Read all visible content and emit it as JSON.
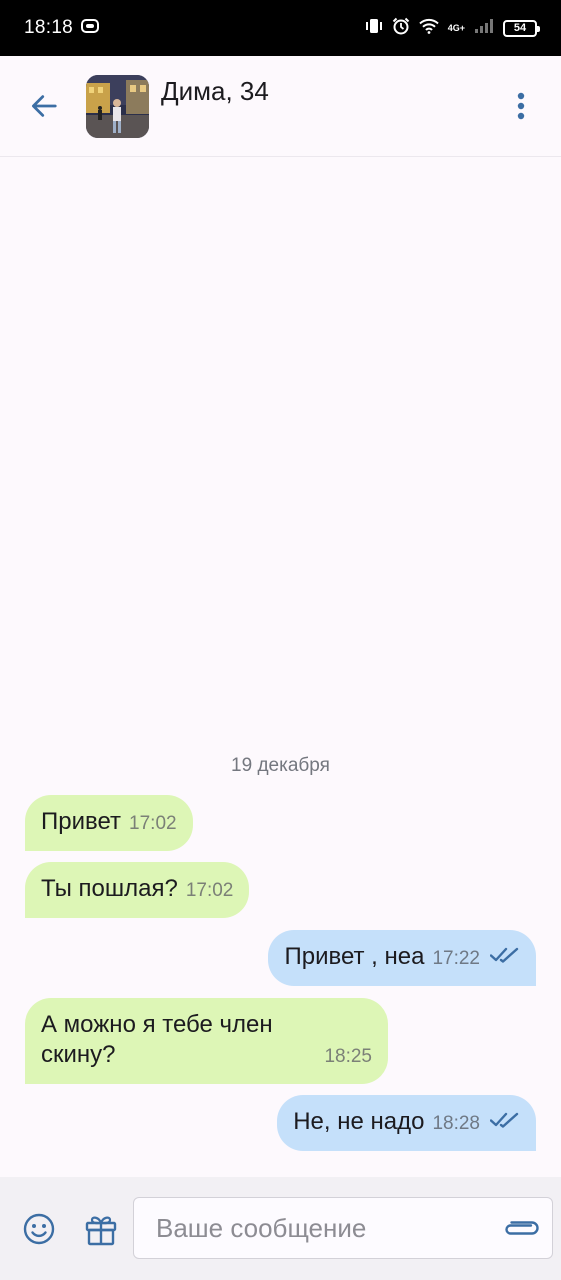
{
  "status_bar": {
    "time": "18:18",
    "network": "4G+",
    "battery": "54"
  },
  "header": {
    "contact_name": "Дима, 34",
    "accent_color": "#3c6ea4"
  },
  "chat": {
    "date_separator": "19 декабря",
    "messages": [
      {
        "direction": "in",
        "text": "Привет",
        "time": "17:02"
      },
      {
        "direction": "in",
        "text": "Ты пошлая?",
        "time": "17:02"
      },
      {
        "direction": "out",
        "text": "Привет , неа",
        "time": "17:22",
        "read": true
      },
      {
        "direction": "in",
        "line1": "А можно я тебе член",
        "line2": "скину?",
        "time": "18:25"
      },
      {
        "direction": "out",
        "text": "Не, не надо",
        "time": "18:28",
        "read": true
      }
    ]
  },
  "composer": {
    "placeholder": "Ваше сообщение",
    "value": "",
    "icons": [
      "emoji-icon",
      "gift-icon",
      "paperclip-icon"
    ]
  },
  "colors": {
    "incoming_bubble": "#ddf6b6",
    "outgoing_bubble": "#c5e0fa",
    "background": "#fdf9fd"
  }
}
